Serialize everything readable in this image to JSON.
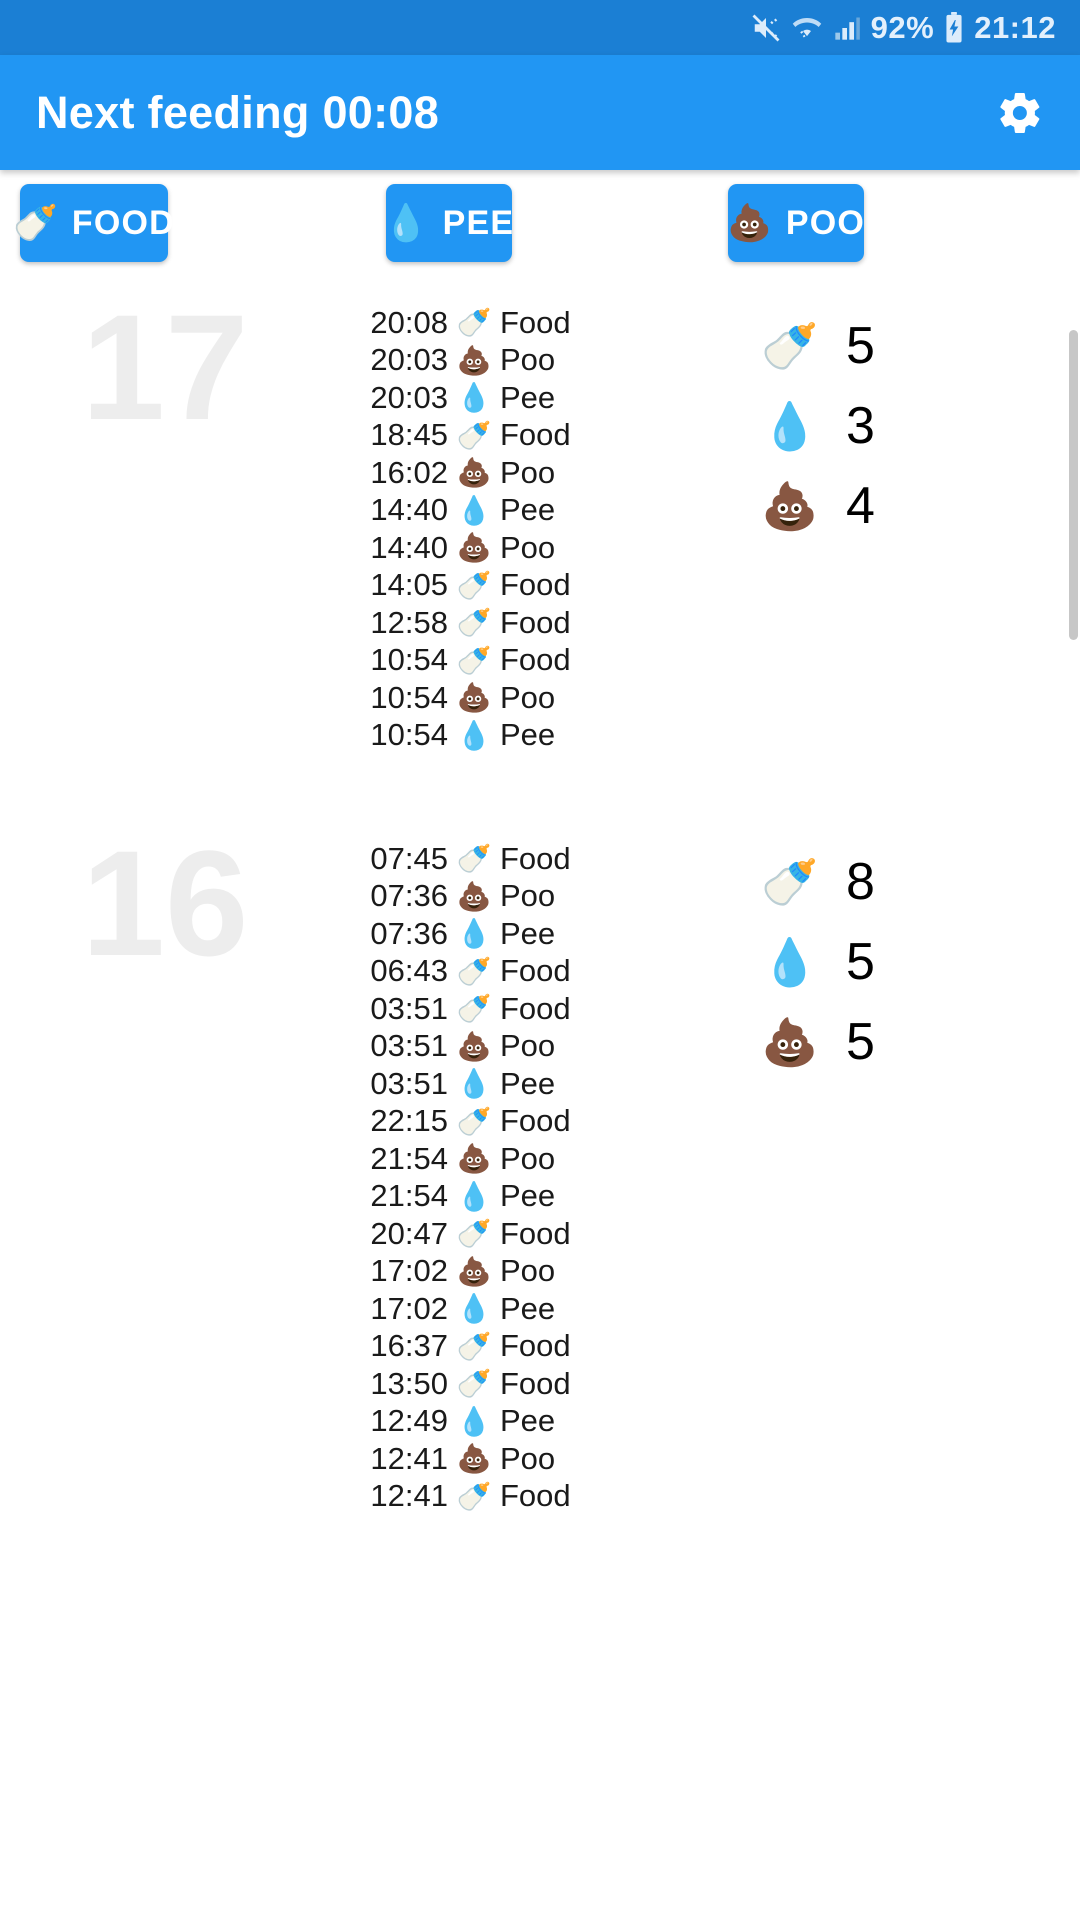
{
  "status_bar": {
    "icons": [
      "mute-vibrate-icon",
      "wifi-icon",
      "cellular-signal-icon"
    ],
    "battery_percent": "92%",
    "battery_state": "charging",
    "clock": "21:12",
    "background_color": "#1b7fd4"
  },
  "app_bar": {
    "title": "Next feeding 00:08",
    "settings_icon": "gear-icon",
    "background_color": "#2196f3"
  },
  "action_buttons": [
    {
      "id": "food",
      "emoji": "🍼",
      "label": "FOOD",
      "icon_name": "baby-bottle-icon"
    },
    {
      "id": "pee",
      "emoji": "💧",
      "label": "PEE",
      "icon_name": "water-drop-icon"
    },
    {
      "id": "poo",
      "emoji": "💩",
      "label": "POO",
      "icon_name": "poop-icon"
    }
  ],
  "days": [
    {
      "day_number": "17",
      "events": [
        {
          "time": "20:08",
          "emoji": "🍼",
          "label": "Food"
        },
        {
          "time": "20:03",
          "emoji": "💩",
          "label": "Poo"
        },
        {
          "time": "20:03",
          "emoji": "💧",
          "label": "Pee"
        },
        {
          "time": "18:45",
          "emoji": "🍼",
          "label": "Food"
        },
        {
          "time": "16:02",
          "emoji": "💩",
          "label": "Poo"
        },
        {
          "time": "14:40",
          "emoji": "💧",
          "label": "Pee"
        },
        {
          "time": "14:40",
          "emoji": "💩",
          "label": "Poo"
        },
        {
          "time": "14:05",
          "emoji": "🍼",
          "label": "Food"
        },
        {
          "time": "12:58",
          "emoji": "🍼",
          "label": "Food"
        },
        {
          "time": "10:54",
          "emoji": "🍼",
          "label": "Food"
        },
        {
          "time": "10:54",
          "emoji": "💩",
          "label": "Poo"
        },
        {
          "time": "10:54",
          "emoji": "💧",
          "label": "Pee"
        }
      ],
      "summary": [
        {
          "emoji": "🍼",
          "icon_name": "baby-bottle-icon",
          "count": "5"
        },
        {
          "emoji": "💧",
          "icon_name": "water-drop-icon",
          "count": "3"
        },
        {
          "emoji": "💩",
          "icon_name": "poop-icon",
          "count": "4"
        }
      ]
    },
    {
      "day_number": "16",
      "events": [
        {
          "time": "07:45",
          "emoji": "🍼",
          "label": "Food"
        },
        {
          "time": "07:36",
          "emoji": "💩",
          "label": "Poo"
        },
        {
          "time": "07:36",
          "emoji": "💧",
          "label": "Pee"
        },
        {
          "time": "06:43",
          "emoji": "🍼",
          "label": "Food"
        },
        {
          "time": "03:51",
          "emoji": "🍼",
          "label": "Food"
        },
        {
          "time": "03:51",
          "emoji": "💩",
          "label": "Poo"
        },
        {
          "time": "03:51",
          "emoji": "💧",
          "label": "Pee"
        },
        {
          "time": "22:15",
          "emoji": "🍼",
          "label": "Food"
        },
        {
          "time": "21:54",
          "emoji": "💩",
          "label": "Poo"
        },
        {
          "time": "21:54",
          "emoji": "💧",
          "label": "Pee"
        },
        {
          "time": "20:47",
          "emoji": "🍼",
          "label": "Food"
        },
        {
          "time": "17:02",
          "emoji": "💩",
          "label": "Poo"
        },
        {
          "time": "17:02",
          "emoji": "💧",
          "label": "Pee"
        },
        {
          "time": "16:37",
          "emoji": "🍼",
          "label": "Food"
        },
        {
          "time": "13:50",
          "emoji": "🍼",
          "label": "Food"
        },
        {
          "time": "12:49",
          "emoji": "💧",
          "label": "Pee"
        },
        {
          "time": "12:41",
          "emoji": "💩",
          "label": "Poo"
        },
        {
          "time": "12:41",
          "emoji": "🍼",
          "label": "Food"
        }
      ],
      "summary": [
        {
          "emoji": "🍼",
          "icon_name": "baby-bottle-icon",
          "count": "8"
        },
        {
          "emoji": "💧",
          "icon_name": "water-drop-icon",
          "count": "5"
        },
        {
          "emoji": "💩",
          "icon_name": "poop-icon",
          "count": "5"
        }
      ]
    }
  ],
  "scrollbar": {
    "visible": true,
    "color": "#c7c7c7"
  }
}
